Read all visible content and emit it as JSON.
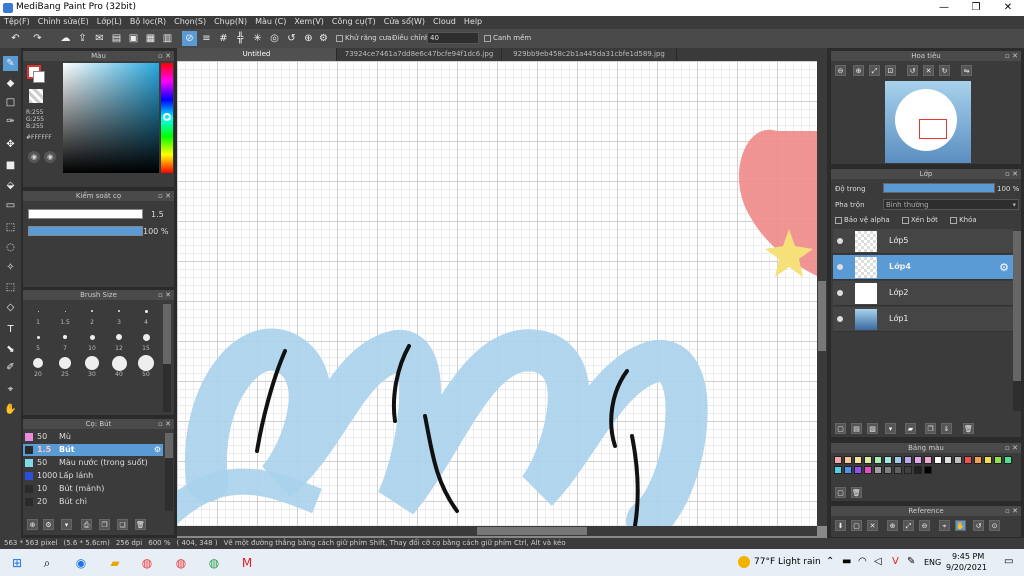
{
  "window": {
    "title": "MediBang Paint Pro (32bit)"
  },
  "menu": [
    "Tệp(F)",
    "Chỉnh sửa(E)",
    "Lớp(L)",
    "Bộ lọc(R)",
    "Chọn(S)",
    "Chụp(N)",
    "Màu (C)",
    "Xem(V)",
    "Công cụ(T)",
    "Cửa sổ(W)",
    "Cloud",
    "Help"
  ],
  "toolbar": {
    "antialias_label": "Khử răng cưa",
    "correction_label": "Điều chỉnh",
    "correction_value": "40",
    "sharp_label": "Canh mềm"
  },
  "tabs": [
    {
      "label": "Untitled"
    },
    {
      "label": "73924ce7461a7dd8e6c47bcfe94f1dc6.jpg"
    },
    {
      "label": "929bb9eb458c2b1a445da31cbfe1d589.jpg"
    }
  ],
  "color_panel": {
    "title": "Màu",
    "r": "R:255",
    "g": "G:255",
    "b": "B:255",
    "hex": "#FFFFFF"
  },
  "brush_control": {
    "title": "Kiểm soát cọ",
    "size_value": "1.5",
    "opacity_value": "100 %"
  },
  "brush_size": {
    "title": "Brush Size",
    "labels": [
      "1",
      "1.5",
      "2",
      "3",
      "4",
      "5",
      "7",
      "10",
      "12",
      "15",
      "20",
      "25",
      "30",
      "40",
      "50"
    ]
  },
  "brush_list": {
    "title": "Cọ: Bút",
    "items": [
      {
        "size": "50",
        "name": "Mù",
        "color": "#e98be0"
      },
      {
        "size": "1.5",
        "name": "Bút",
        "color": "#2a2a2a"
      },
      {
        "size": "50",
        "name": "Màu nước (trong suốt)",
        "color": "#7fd9e6"
      },
      {
        "size": "1000",
        "name": "Lấp lánh",
        "color": "#2d4fd8"
      },
      {
        "size": "10",
        "name": "Bút (mảnh)",
        "color": "#2a2a2a"
      },
      {
        "size": "20",
        "name": "Bút chì",
        "color": "#2a2a2a"
      }
    ]
  },
  "navigator": {
    "title": "Hoa tiêu"
  },
  "layer_panel": {
    "title": "Lớp",
    "opacity_label": "Độ trong",
    "opacity_value": "100 %",
    "blend_label": "Pha trộn",
    "blend_value": "Bình thường",
    "protect_alpha": "Bảo vệ alpha",
    "clipping": "Xén bớt",
    "lock": "Khóa",
    "layers": [
      {
        "name": "Lớp5"
      },
      {
        "name": "Lớp4"
      },
      {
        "name": "Lớp2"
      },
      {
        "name": "Lớp1"
      }
    ]
  },
  "palette_panel": {
    "title": "Bảng màu"
  },
  "reference_panel": {
    "title": "Reference"
  },
  "status": {
    "size": "563 * 563 pixel",
    "physical": "(5.6 * 5.6cm)",
    "dpi": "256 dpi",
    "zoom": "600 %",
    "coord": "( 404, 348 )",
    "hint": "Vẽ một đường thẳng bằng cách giữ phím Shift, Thay đổi cỡ cọ bằng cách giữ phím Ctrl, Alt và kéo"
  },
  "taskbar": {
    "weather": "77°F  Light rain",
    "lang": "ENG",
    "time": "9:45 PM",
    "date": "9/20/2021"
  },
  "palette_colors": [
    "#f4a8a8",
    "#f7c8a0",
    "#f7e6a0",
    "#d8f0a0",
    "#a8f0b8",
    "#a0e8e0",
    "#a0c8f0",
    "#b8a8f0",
    "#e0a8f0",
    "#f0a8d0",
    "#ffffff",
    "#e0e0e0",
    "#c0c0c0",
    "#f05050",
    "#f0a050",
    "#f0e050",
    "#90e050",
    "#50e090",
    "#50d0e0",
    "#5090f0",
    "#9050f0",
    "#e050c0",
    "#a0a0a0",
    "#808080",
    "#606060",
    "#404040",
    "#202020",
    "#000000"
  ],
  "colors": {
    "accent": "#5b9bd5",
    "panel": "#3b3b3b"
  }
}
